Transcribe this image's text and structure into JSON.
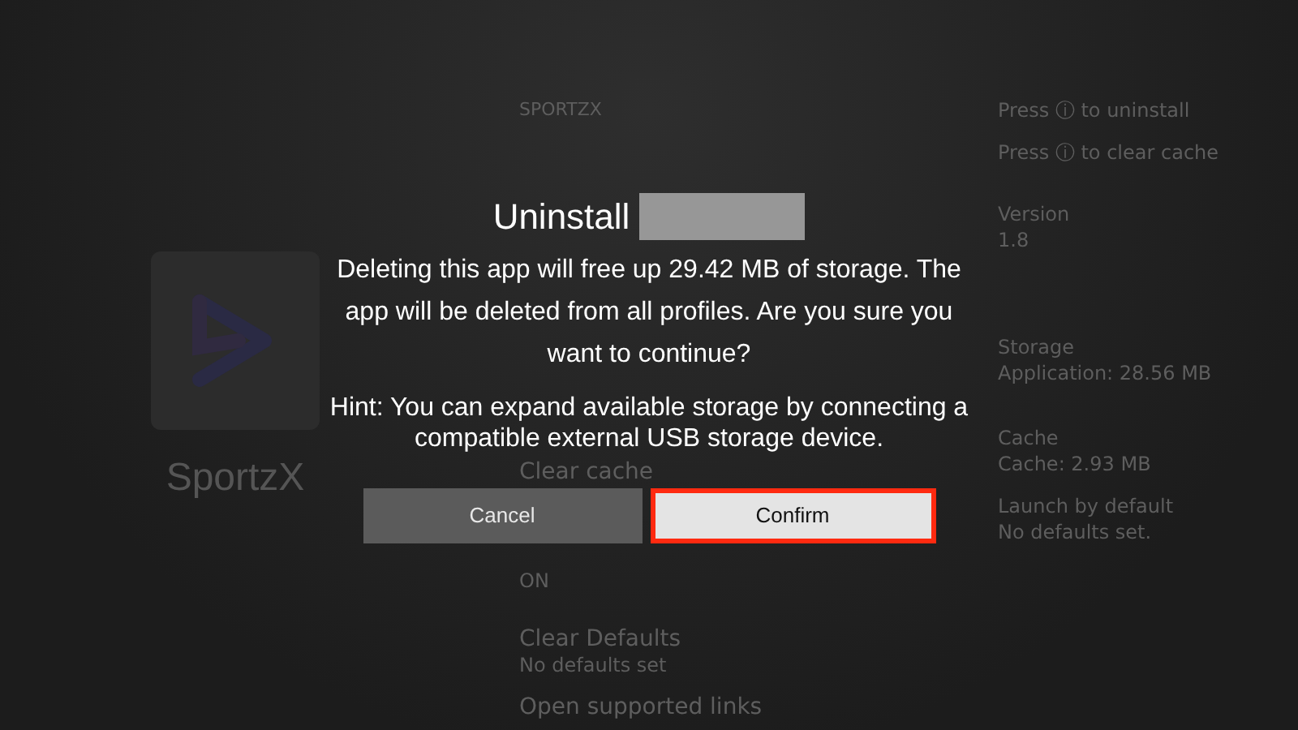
{
  "app_panel": {
    "name": "SportzX"
  },
  "settings": {
    "header": "SPORTZX",
    "items": [
      {
        "title": "Clear cache"
      },
      {
        "value": "ON"
      },
      {
        "title": "Clear Defaults",
        "value": "No defaults set"
      },
      {
        "title": "Open supported links"
      }
    ]
  },
  "info": {
    "hints": [
      "Press ⓘ to uninstall",
      "Press ⓘ to clear cache"
    ],
    "sections": [
      {
        "title": "Version",
        "lines": [
          "1.8"
        ]
      },
      {
        "title": "Storage",
        "lines": [
          "Application: 28.56 MB"
        ]
      },
      {
        "title": "Cache",
        "lines": [
          "Cache: 2.93 MB"
        ]
      },
      {
        "title": "Launch by default",
        "lines": [
          "No defaults set."
        ]
      }
    ]
  },
  "dialog": {
    "title": "Uninstall",
    "title_redacted": true,
    "message": "Deleting this app will free up 29.42 MB of storage. The app will be deleted from all profiles. Are you sure you want to continue?",
    "hint": "Hint: You can expand available storage by connecting a compatible external USB storage device.",
    "buttons": [
      {
        "label": "Cancel",
        "selected": false
      },
      {
        "label": "Confirm",
        "selected": true
      }
    ]
  }
}
